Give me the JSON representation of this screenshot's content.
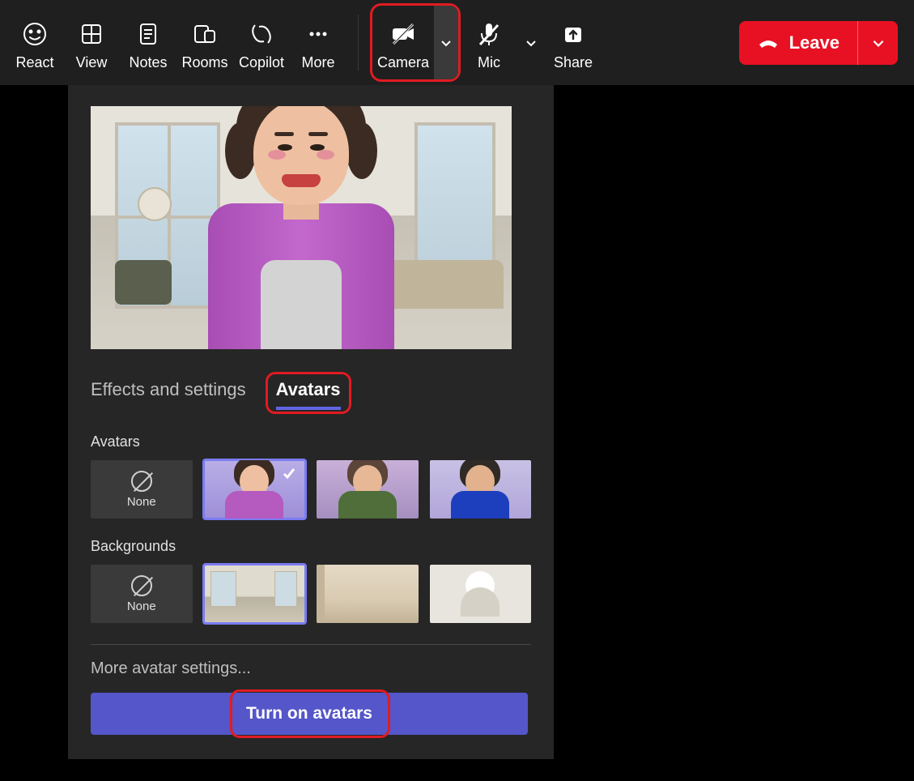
{
  "toolbar": {
    "react": "React",
    "view": "View",
    "notes": "Notes",
    "rooms": "Rooms",
    "copilot": "Copilot",
    "more": "More",
    "camera": "Camera",
    "mic": "Mic",
    "share": "Share",
    "leave": "Leave"
  },
  "panel": {
    "tab_effects": "Effects and settings",
    "tab_avatars": "Avatars",
    "avatars_label": "Avatars",
    "none_label": "None",
    "backgrounds_label": "Backgrounds",
    "more_settings": "More avatar settings...",
    "turn_on": "Turn on avatars"
  },
  "icons": {
    "react": "smile-icon",
    "view": "grid-icon",
    "notes": "note-icon",
    "rooms": "rooms-icon",
    "copilot": "copilot-icon",
    "more": "ellipsis-icon",
    "camera": "camera-off-icon",
    "mic": "mic-off-icon",
    "share": "share-icon",
    "leave": "phone-hangup-icon"
  }
}
